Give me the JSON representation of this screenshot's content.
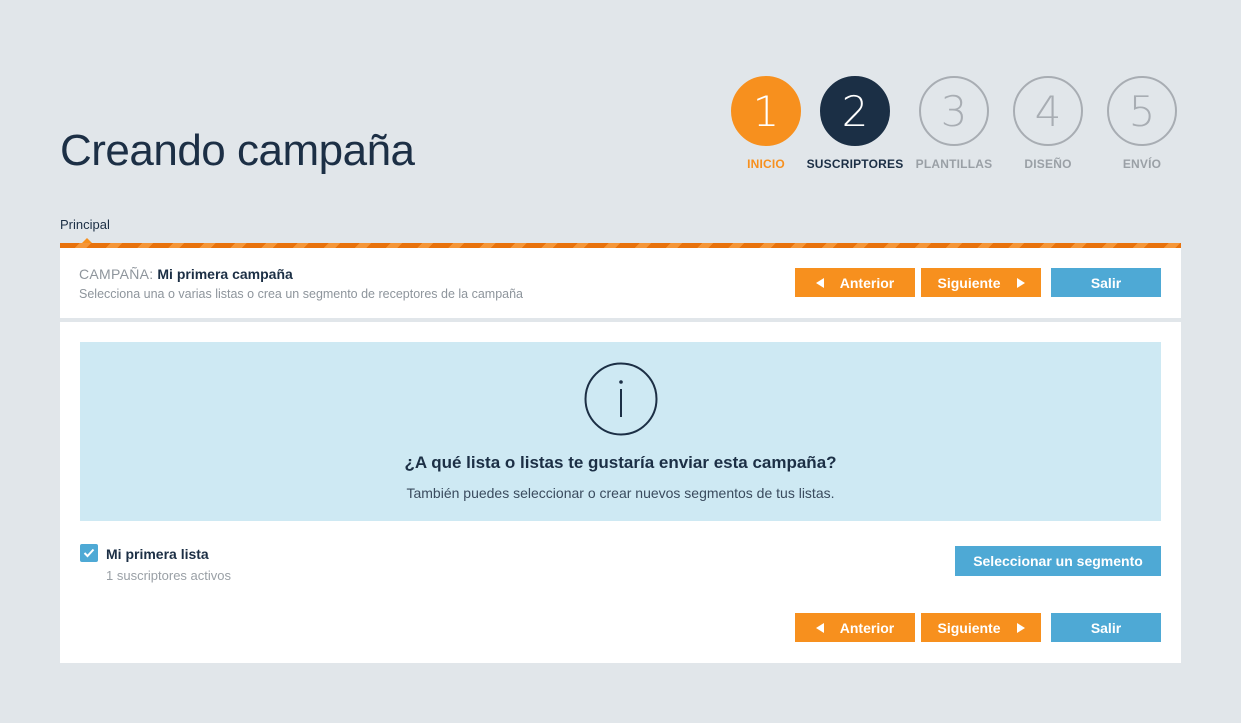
{
  "page": {
    "title": "Creando campaña"
  },
  "steps": [
    {
      "number": "1",
      "label": "INICIO",
      "state": "done"
    },
    {
      "number": "2",
      "label": "SUSCRIPTORES",
      "state": "active"
    },
    {
      "number": "3",
      "label": "PLANTILLAS",
      "state": "pending"
    },
    {
      "number": "4",
      "label": "DISEÑO",
      "state": "pending"
    },
    {
      "number": "5",
      "label": "ENVÍO",
      "state": "pending"
    }
  ],
  "tab": {
    "label": "Principal"
  },
  "campaign": {
    "prefix": "CAMPAÑA:",
    "name": "Mi primera campaña",
    "description": "Selecciona una o varias listas o crea un segmento de receptores de la campaña"
  },
  "nav": {
    "prev": "Anterior",
    "next": "Siguiente",
    "exit": "Salir"
  },
  "info": {
    "icon": "info-circle-icon",
    "title": "¿A qué lista o listas te gustaría enviar esta campaña?",
    "subtitle": "También puedes seleccionar o crear nuevos segmentos de tus listas."
  },
  "lists": [
    {
      "name": "Mi primera lista",
      "subscribers": "1 suscriptores activos",
      "checked": true
    }
  ],
  "segment_button": "Seleccionar un segmento",
  "colors": {
    "orange": "#f7901e",
    "navy": "#1b2f45",
    "blue": "#4ea9d5",
    "info_bg": "#cee9f3",
    "background": "#e1e6ea"
  }
}
